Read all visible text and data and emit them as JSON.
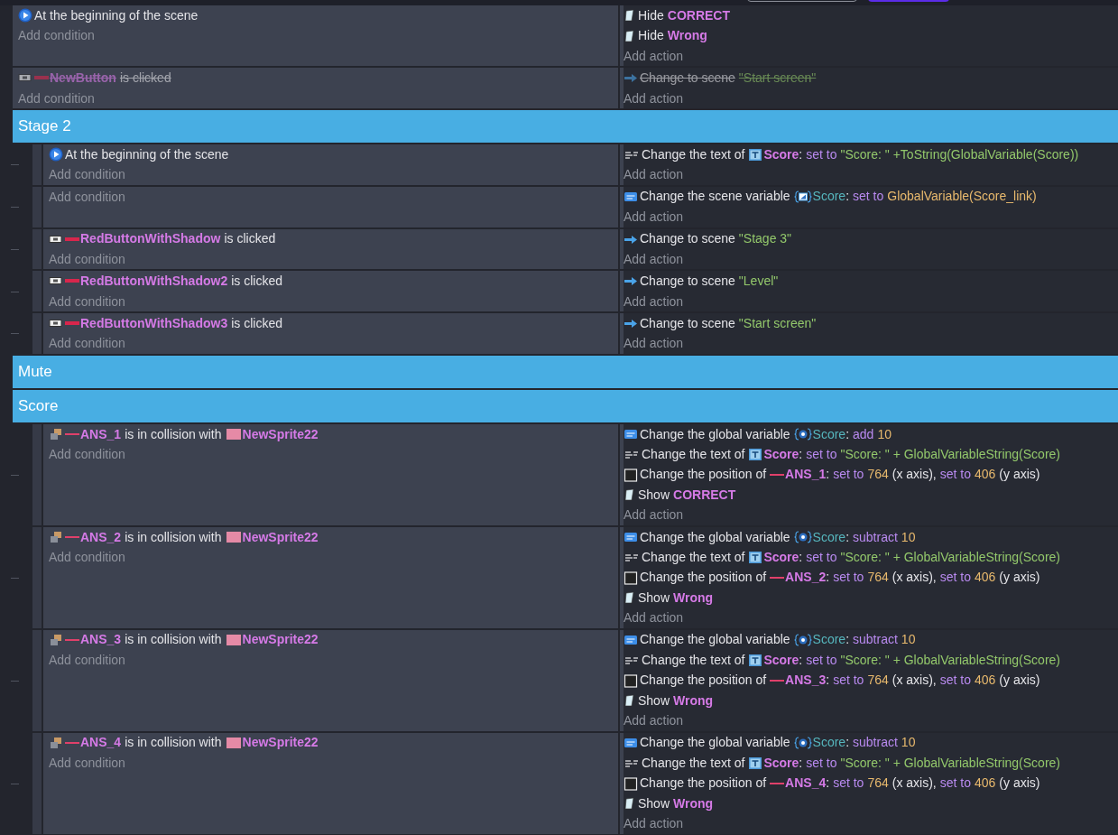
{
  "events": [
    {
      "kind": "event",
      "disabled": false,
      "conditions": [
        {
          "kind": "scene-start",
          "parts": [
            {
              "kind": "text",
              "text": "At the beginning of the scene"
            }
          ]
        }
      ],
      "add_condition": "Add condition",
      "actions": [
        {
          "kind": "visibility",
          "parts": [
            {
              "kind": "text",
              "text": "Hide"
            },
            {
              "kind": "object",
              "text": "CORRECT"
            }
          ]
        },
        {
          "kind": "visibility",
          "parts": [
            {
              "kind": "text",
              "text": "Hide"
            },
            {
              "kind": "object",
              "text": "Wrong"
            }
          ]
        }
      ],
      "add_action": "Add action"
    },
    {
      "kind": "event",
      "disabled": true,
      "conditions": [
        {
          "kind": "button-click",
          "parts": [
            {
              "kind": "bar-object",
              "text": "NewButton"
            },
            {
              "kind": "text",
              "text": "is clicked"
            }
          ]
        }
      ],
      "add_condition": "Add condition",
      "actions": [
        {
          "kind": "scene-change",
          "parts": [
            {
              "kind": "text",
              "text": "Change to scene"
            },
            {
              "kind": "string",
              "text": "\"Start screen\""
            }
          ]
        }
      ],
      "add_action": "Add action"
    },
    {
      "kind": "group",
      "title": "Stage 2",
      "children": [
        {
          "kind": "event",
          "disabled": false,
          "conditions": [
            {
              "kind": "scene-start",
              "parts": [
                {
                  "kind": "text",
                  "text": "At the beginning of the scene"
                }
              ]
            }
          ],
          "add_condition": "Add condition",
          "actions": [
            {
              "kind": "text-change",
              "parts": [
                {
                  "kind": "text",
                  "text": "Change the text of"
                },
                {
                  "kind": "text-object",
                  "text": "Score"
                },
                {
                  "kind": "text",
                  "text": ":",
                  "attached": true
                },
                {
                  "kind": "param",
                  "text": "set to"
                },
                {
                  "kind": "string",
                  "text": "\"Score: \" +ToString(GlobalVariable(Score))"
                }
              ]
            }
          ],
          "add_action": "Add action"
        },
        {
          "kind": "event",
          "disabled": false,
          "add_condition": "Add condition",
          "actions": [
            {
              "kind": "variable-change",
              "parts": [
                {
                  "kind": "text",
                  "text": "Change the scene variable"
                },
                {
                  "kind": "scene-variable",
                  "text": "Score"
                },
                {
                  "kind": "text",
                  "text": ":",
                  "attached": true
                },
                {
                  "kind": "param",
                  "text": "set to"
                },
                {
                  "kind": "number",
                  "text": "GlobalVariable(Score_link)"
                }
              ]
            }
          ],
          "add_action": "Add action"
        },
        {
          "kind": "event",
          "disabled": false,
          "conditions": [
            {
              "kind": "button-click",
              "parts": [
                {
                  "kind": "bar-object",
                  "text": "RedButtonWithShadow"
                },
                {
                  "kind": "text",
                  "text": "is clicked"
                }
              ]
            }
          ],
          "add_condition": "Add condition",
          "actions": [
            {
              "kind": "scene-change",
              "parts": [
                {
                  "kind": "text",
                  "text": "Change to scene"
                },
                {
                  "kind": "string",
                  "text": "\"Stage 3\""
                }
              ]
            }
          ],
          "add_action": "Add action"
        },
        {
          "kind": "event",
          "disabled": false,
          "conditions": [
            {
              "kind": "button-click",
              "parts": [
                {
                  "kind": "bar-object",
                  "text": "RedButtonWithShadow2"
                },
                {
                  "kind": "text",
                  "text": "is clicked"
                }
              ]
            }
          ],
          "add_condition": "Add condition",
          "actions": [
            {
              "kind": "scene-change",
              "parts": [
                {
                  "kind": "text",
                  "text": "Change to scene"
                },
                {
                  "kind": "string",
                  "text": "\"Level\""
                }
              ]
            }
          ],
          "add_action": "Add action"
        },
        {
          "kind": "event",
          "disabled": false,
          "conditions": [
            {
              "kind": "button-click",
              "parts": [
                {
                  "kind": "bar-object",
                  "text": "RedButtonWithShadow3"
                },
                {
                  "kind": "text",
                  "text": "is clicked"
                }
              ]
            }
          ],
          "add_condition": "Add condition",
          "actions": [
            {
              "kind": "scene-change",
              "parts": [
                {
                  "kind": "text",
                  "text": "Change to scene"
                },
                {
                  "kind": "string",
                  "text": "\"Start screen\""
                }
              ]
            }
          ],
          "add_action": "Add action"
        }
      ]
    },
    {
      "kind": "group",
      "title": "Mute"
    },
    {
      "kind": "group",
      "title": "Score",
      "children": [
        {
          "kind": "event",
          "disabled": false,
          "conditions": [
            {
              "kind": "collision",
              "parts": [
                {
                  "kind": "line-object",
                  "text": "ANS_1"
                },
                {
                  "kind": "text",
                  "text": "is in collision with"
                },
                {
                  "kind": "sprite-object",
                  "text": "NewSprite22"
                }
              ]
            }
          ],
          "add_condition": "Add condition",
          "actions": [
            {
              "kind": "variable-change",
              "parts": [
                {
                  "kind": "text",
                  "text": "Change the global variable"
                },
                {
                  "kind": "global-variable",
                  "text": "Score"
                },
                {
                  "kind": "text",
                  "text": ":",
                  "attached": true
                },
                {
                  "kind": "param",
                  "text": "add"
                },
                {
                  "kind": "number",
                  "text": "10"
                }
              ]
            },
            {
              "kind": "text-change",
              "parts": [
                {
                  "kind": "text",
                  "text": "Change the text of"
                },
                {
                  "kind": "text-object",
                  "text": "Score"
                },
                {
                  "kind": "text",
                  "text": ":",
                  "attached": true
                },
                {
                  "kind": "param",
                  "text": "set to"
                },
                {
                  "kind": "string",
                  "text": "\"Score: \" + GlobalVariableString(Score)"
                }
              ]
            },
            {
              "kind": "position",
              "parts": [
                {
                  "kind": "text",
                  "text": "Change the position of"
                },
                {
                  "kind": "line-object",
                  "text": "ANS_1"
                },
                {
                  "kind": "text",
                  "text": ":",
                  "attached": true
                },
                {
                  "kind": "param",
                  "text": "set to"
                },
                {
                  "kind": "number",
                  "text": "764"
                },
                {
                  "kind": "text",
                  "text": "(x axis),"
                },
                {
                  "kind": "param",
                  "text": "set to"
                },
                {
                  "kind": "number",
                  "text": "406"
                },
                {
                  "kind": "text",
                  "text": "(y axis)"
                }
              ]
            },
            {
              "kind": "visibility",
              "parts": [
                {
                  "kind": "text",
                  "text": "Show"
                },
                {
                  "kind": "object",
                  "text": "CORRECT"
                }
              ]
            }
          ],
          "add_action": "Add action"
        },
        {
          "kind": "event",
          "disabled": false,
          "conditions": [
            {
              "kind": "collision",
              "parts": [
                {
                  "kind": "line-object",
                  "text": "ANS_2"
                },
                {
                  "kind": "text",
                  "text": "is in collision with"
                },
                {
                  "kind": "sprite-object",
                  "text": "NewSprite22"
                }
              ]
            }
          ],
          "add_condition": "Add condition",
          "actions": [
            {
              "kind": "variable-change",
              "parts": [
                {
                  "kind": "text",
                  "text": "Change the global variable"
                },
                {
                  "kind": "global-variable",
                  "text": "Score"
                },
                {
                  "kind": "text",
                  "text": ":",
                  "attached": true
                },
                {
                  "kind": "param",
                  "text": "subtract"
                },
                {
                  "kind": "number",
                  "text": "10"
                }
              ]
            },
            {
              "kind": "text-change",
              "parts": [
                {
                  "kind": "text",
                  "text": "Change the text of"
                },
                {
                  "kind": "text-object",
                  "text": "Score"
                },
                {
                  "kind": "text",
                  "text": ":",
                  "attached": true
                },
                {
                  "kind": "param",
                  "text": "set to"
                },
                {
                  "kind": "string",
                  "text": "\"Score: \" + GlobalVariableString(Score)"
                }
              ]
            },
            {
              "kind": "position",
              "parts": [
                {
                  "kind": "text",
                  "text": "Change the position of"
                },
                {
                  "kind": "line-object",
                  "text": "ANS_2"
                },
                {
                  "kind": "text",
                  "text": ":",
                  "attached": true
                },
                {
                  "kind": "param",
                  "text": "set to"
                },
                {
                  "kind": "number",
                  "text": "764"
                },
                {
                  "kind": "text",
                  "text": "(x axis),"
                },
                {
                  "kind": "param",
                  "text": "set to"
                },
                {
                  "kind": "number",
                  "text": "406"
                },
                {
                  "kind": "text",
                  "text": "(y axis)"
                }
              ]
            },
            {
              "kind": "visibility",
              "parts": [
                {
                  "kind": "text",
                  "text": "Show"
                },
                {
                  "kind": "object",
                  "text": "Wrong"
                }
              ]
            }
          ],
          "add_action": "Add action"
        },
        {
          "kind": "event",
          "disabled": false,
          "conditions": [
            {
              "kind": "collision",
              "parts": [
                {
                  "kind": "line-object",
                  "text": "ANS_3"
                },
                {
                  "kind": "text",
                  "text": "is in collision with"
                },
                {
                  "kind": "sprite-object",
                  "text": "NewSprite22"
                }
              ]
            }
          ],
          "add_condition": "Add condition",
          "actions": [
            {
              "kind": "variable-change",
              "parts": [
                {
                  "kind": "text",
                  "text": "Change the global variable"
                },
                {
                  "kind": "global-variable",
                  "text": "Score"
                },
                {
                  "kind": "text",
                  "text": ":",
                  "attached": true
                },
                {
                  "kind": "param",
                  "text": "subtract"
                },
                {
                  "kind": "number",
                  "text": "10"
                }
              ]
            },
            {
              "kind": "text-change",
              "parts": [
                {
                  "kind": "text",
                  "text": "Change the text of"
                },
                {
                  "kind": "text-object",
                  "text": "Score"
                },
                {
                  "kind": "text",
                  "text": ":",
                  "attached": true
                },
                {
                  "kind": "param",
                  "text": "set to"
                },
                {
                  "kind": "string",
                  "text": "\"Score: \" + GlobalVariableString(Score)"
                }
              ]
            },
            {
              "kind": "position",
              "parts": [
                {
                  "kind": "text",
                  "text": "Change the position of"
                },
                {
                  "kind": "line-object",
                  "text": "ANS_3"
                },
                {
                  "kind": "text",
                  "text": ":",
                  "attached": true
                },
                {
                  "kind": "param",
                  "text": "set to"
                },
                {
                  "kind": "number",
                  "text": "764"
                },
                {
                  "kind": "text",
                  "text": "(x axis),"
                },
                {
                  "kind": "param",
                  "text": "set to"
                },
                {
                  "kind": "number",
                  "text": "406"
                },
                {
                  "kind": "text",
                  "text": "(y axis)"
                }
              ]
            },
            {
              "kind": "visibility",
              "parts": [
                {
                  "kind": "text",
                  "text": "Show"
                },
                {
                  "kind": "object",
                  "text": "Wrong"
                }
              ]
            }
          ],
          "add_action": "Add action"
        },
        {
          "kind": "event",
          "disabled": false,
          "conditions": [
            {
              "kind": "collision",
              "parts": [
                {
                  "kind": "line-object",
                  "text": "ANS_4"
                },
                {
                  "kind": "text",
                  "text": "is in collision with"
                },
                {
                  "kind": "sprite-object",
                  "text": "NewSprite22"
                }
              ]
            }
          ],
          "add_condition": "Add condition",
          "actions": [
            {
              "kind": "variable-change",
              "parts": [
                {
                  "kind": "text",
                  "text": "Change the global variable"
                },
                {
                  "kind": "global-variable",
                  "text": "Score"
                },
                {
                  "kind": "text",
                  "text": ":",
                  "attached": true
                },
                {
                  "kind": "param",
                  "text": "subtract"
                },
                {
                  "kind": "number",
                  "text": "10"
                }
              ]
            },
            {
              "kind": "text-change",
              "parts": [
                {
                  "kind": "text",
                  "text": "Change the text of"
                },
                {
                  "kind": "text-object",
                  "text": "Score"
                },
                {
                  "kind": "text",
                  "text": ":",
                  "attached": true
                },
                {
                  "kind": "param",
                  "text": "set to"
                },
                {
                  "kind": "string",
                  "text": "\"Score: \" + GlobalVariableString(Score)"
                }
              ]
            },
            {
              "kind": "position",
              "parts": [
                {
                  "kind": "text",
                  "text": "Change the position of"
                },
                {
                  "kind": "line-object",
                  "text": "ANS_4"
                },
                {
                  "kind": "text",
                  "text": ":",
                  "attached": true
                },
                {
                  "kind": "param",
                  "text": "set to"
                },
                {
                  "kind": "number",
                  "text": "764"
                },
                {
                  "kind": "text",
                  "text": "(x axis),"
                },
                {
                  "kind": "param",
                  "text": "set to"
                },
                {
                  "kind": "number",
                  "text": "406"
                },
                {
                  "kind": "text",
                  "text": "(y axis)"
                }
              ]
            },
            {
              "kind": "visibility",
              "parts": [
                {
                  "kind": "text",
                  "text": "Show"
                },
                {
                  "kind": "object",
                  "text": "Wrong"
                }
              ]
            }
          ],
          "add_action": "Add action"
        }
      ]
    }
  ]
}
